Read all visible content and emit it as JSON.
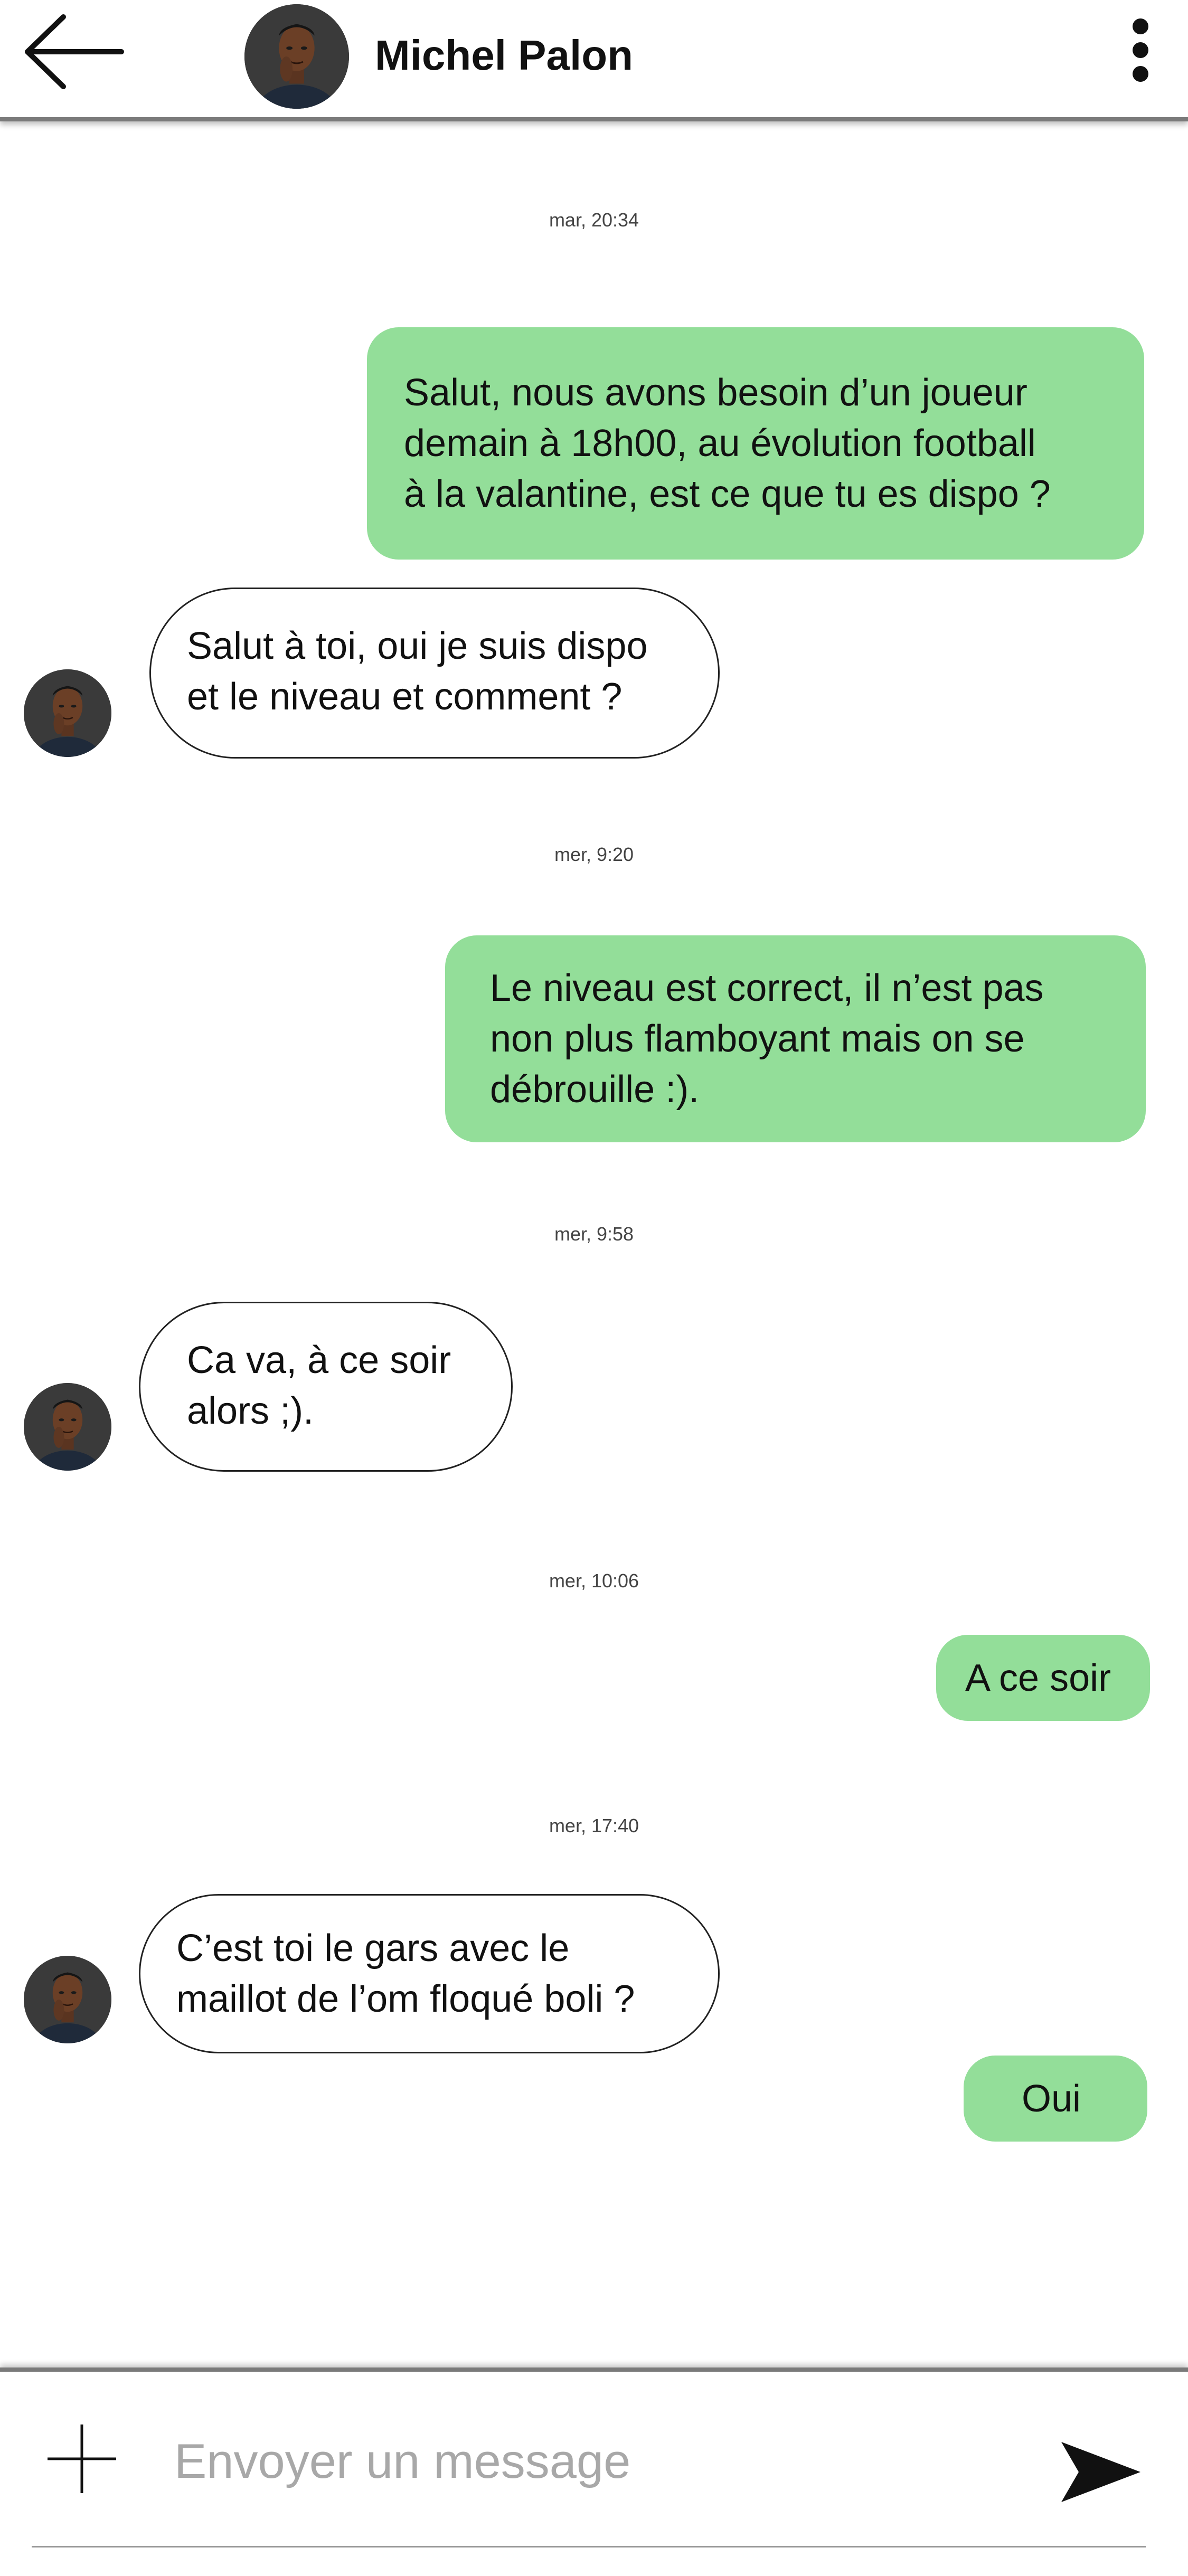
{
  "header": {
    "contact_name": "Michel Palon",
    "back_icon": "arrow-left-icon",
    "menu_icon": "more-vertical-icon"
  },
  "timestamps": [
    "mar, 20:34",
    "mer, 9:20",
    "mer, 9:58",
    "mer, 10:06",
    "mer, 17:40"
  ],
  "messages": [
    {
      "direction": "sent",
      "text": "Salut, nous avons besoin d’un joueur\ndemain à 18h00, au évolution football\nà la valantine, est ce que tu es dispo ?"
    },
    {
      "direction": "received",
      "text": "Salut à toi, oui je suis dispo\net le niveau et comment ?"
    },
    {
      "direction": "sent",
      "text": "Le niveau est correct, il n’est pas\nnon plus flamboyant mais on se\ndébrouille :)."
    },
    {
      "direction": "received",
      "text": "Ca va, à ce soir\nalors ;)."
    },
    {
      "direction": "sent",
      "text": "A ce soir"
    },
    {
      "direction": "received",
      "text": "C’est toi le gars avec le\nmaillot de l’om floqué boli ?"
    },
    {
      "direction": "sent",
      "text": "Oui"
    }
  ],
  "composer": {
    "placeholder": "Envoyer un message",
    "value": "",
    "add_icon": "plus-icon",
    "send_icon": "send-icon"
  },
  "colors": {
    "sent_bubble": "#93de99",
    "received_bubble_border": "#222222",
    "background": "#ffffff"
  }
}
